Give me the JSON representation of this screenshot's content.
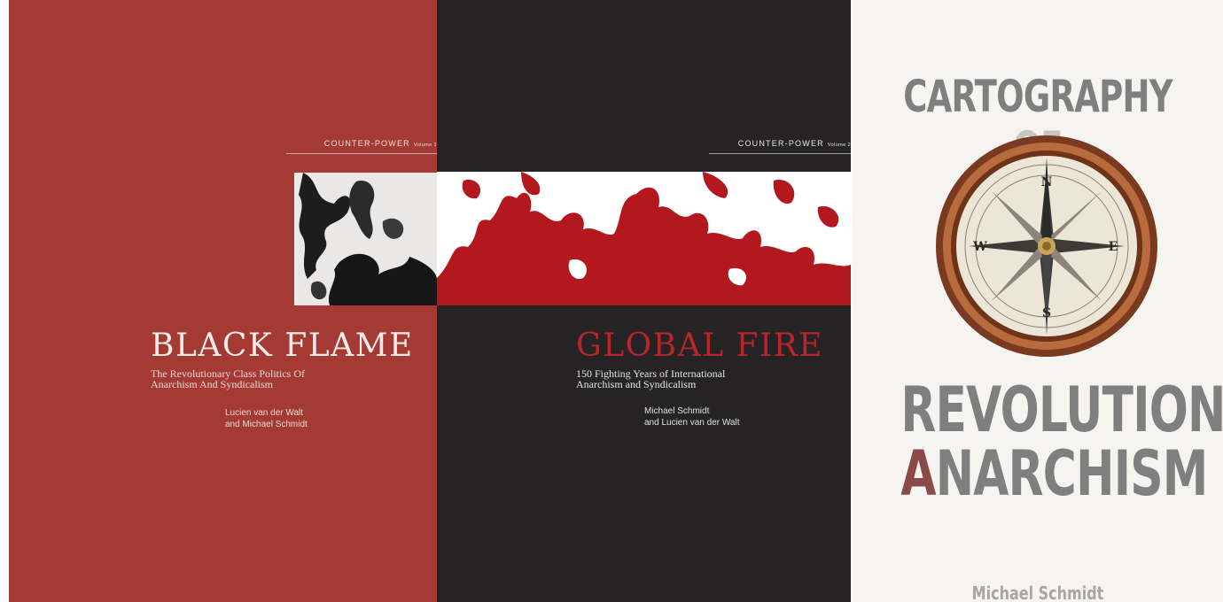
{
  "book1": {
    "series_name": "COUNTER-POWER",
    "series_volume": "Volume 1",
    "title": "BLACK FLAME",
    "subtitle_line1": "The Revolutionary Class Politics Of",
    "subtitle_line2": "Anarchism And Syndicalism",
    "author_line1": "Lucien van der Walt",
    "author_line2": "and Michael Schmidt",
    "background_color": "#a33a33"
  },
  "book2": {
    "series_name": "COUNTER-POWER",
    "series_volume": "Volume 2",
    "title": "GLOBAL FIRE",
    "subtitle_line1": "150 Fighting Years of International",
    "subtitle_line2": "Anarchism and Syndicalism",
    "author_line1": "Michael Schmidt",
    "author_line2": "and Lucien van der Walt",
    "background_color": "#252324",
    "accent_color": "#b8262b"
  },
  "book3": {
    "title_top_main": "CARTOGRAPHY ",
    "title_top_fade": "OF",
    "title_mid": "REVOLUTIONARY",
    "title_bot_accent": "A",
    "title_bot_rest": "NARCHISM",
    "author": "Michael Schmidt",
    "compass": {
      "north": "N",
      "south": "S",
      "east": "E",
      "west": "W"
    },
    "background_color": "#f6f4f1"
  }
}
